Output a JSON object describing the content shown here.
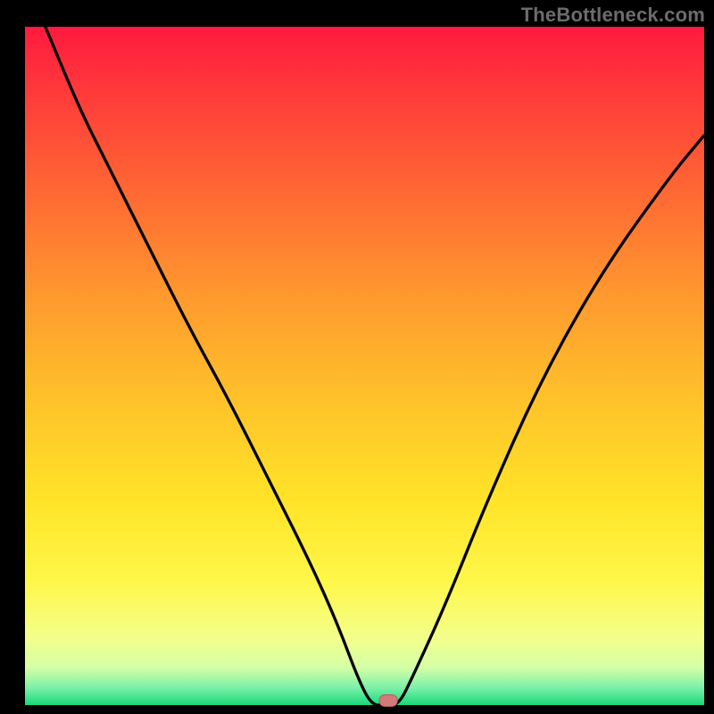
{
  "watermark": "TheBottleneck.com",
  "chart_data": {
    "type": "line",
    "title": "",
    "xlabel": "",
    "ylabel": "",
    "xlim": [
      0,
      100
    ],
    "ylim": [
      0,
      100
    ],
    "series": [
      {
        "name": "bottleneck-curve",
        "x": [
          3,
          8,
          12,
          18,
          24,
          30,
          36,
          42,
          46,
          49,
          51,
          53,
          55,
          57,
          62,
          68,
          76,
          85,
          95,
          100
        ],
        "y": [
          100,
          88,
          80,
          68,
          56,
          45,
          33,
          21,
          12,
          4,
          0,
          0,
          0,
          4,
          15,
          30,
          48,
          64,
          78,
          84
        ]
      }
    ],
    "marker": {
      "x": 53.5,
      "y": 0.6
    },
    "gradient_stops": [
      {
        "offset": 0.0,
        "color": "#ff1a3f"
      },
      {
        "offset": 0.1,
        "color": "#ff3b3a"
      },
      {
        "offset": 0.25,
        "color": "#ff6a33"
      },
      {
        "offset": 0.4,
        "color": "#ff9a2e"
      },
      {
        "offset": 0.55,
        "color": "#ffc22a"
      },
      {
        "offset": 0.7,
        "color": "#ffe428"
      },
      {
        "offset": 0.82,
        "color": "#fff74a"
      },
      {
        "offset": 0.9,
        "color": "#f4ff8a"
      },
      {
        "offset": 0.945,
        "color": "#d4ffa6"
      },
      {
        "offset": 0.975,
        "color": "#7af0a8"
      },
      {
        "offset": 1.0,
        "color": "#18d876"
      }
    ],
    "colors": {
      "curve": "#000000",
      "marker_fill": "#d57a7a",
      "marker_stroke": "#b85a5a"
    }
  }
}
